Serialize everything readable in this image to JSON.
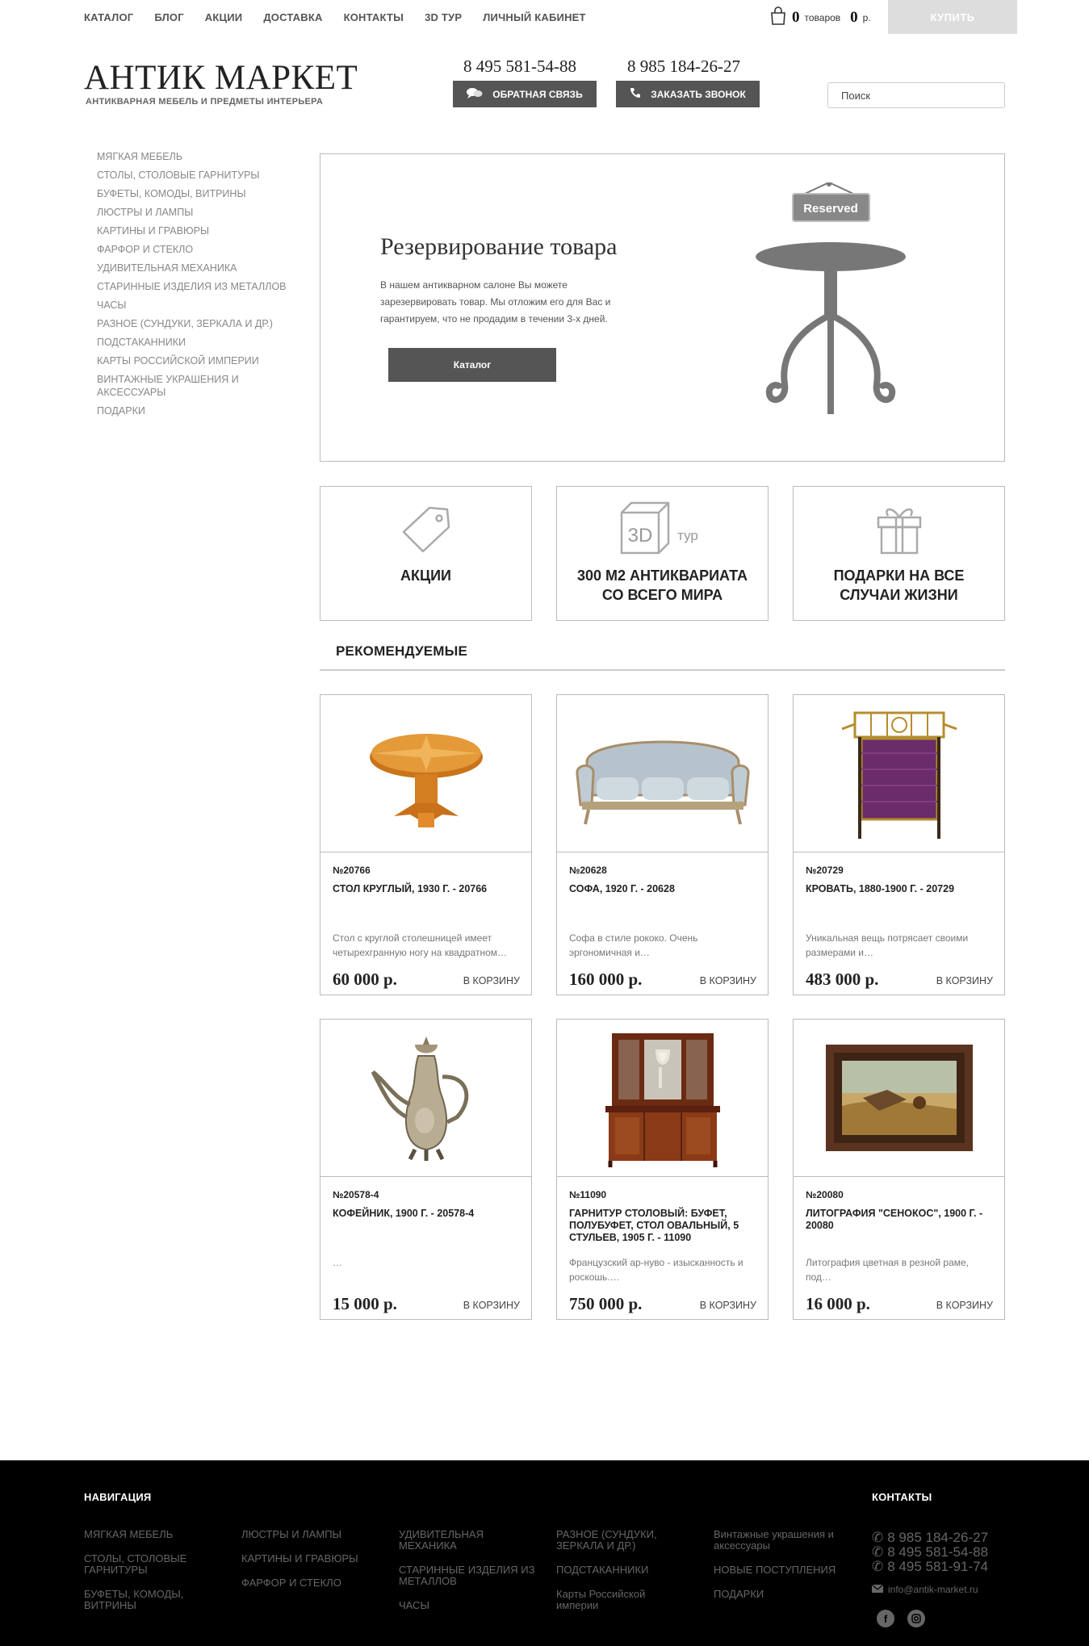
{
  "topnav": [
    "КАТАЛОГ",
    "БЛОГ",
    "АКЦИИ",
    "ДОСТАВКА",
    "КОНТАКТЫ",
    "3D ТУР",
    "ЛИЧНЫЙ КАБИНЕТ"
  ],
  "cart": {
    "count": "0",
    "count_label": "товаров",
    "sum": "0",
    "currency": "р.",
    "buy_label": "КУПИТЬ"
  },
  "header": {
    "logo": "АНТИК МАРКЕТ",
    "tagline": "АНТИКВАРНАЯ МЕБЕЛЬ И ПРЕДМЕТЫ ИНТЕРЬЕРА",
    "phone1": "8 495 581-54-88",
    "phone2": "8 985 184-26-27",
    "feedback_label": "ОБРАТНАЯ СВЯЗЬ",
    "callback_label": "ЗАКАЗАТЬ ЗВОНОК",
    "search_placeholder": "Поиск"
  },
  "sidebar": [
    "МЯГКАЯ МЕБЕЛЬ",
    "СТОЛЫ, СТОЛОВЫЕ ГАРНИТУРЫ",
    "БУФЕТЫ, КОМОДЫ, ВИТРИНЫ",
    "ЛЮСТРЫ И ЛАМПЫ",
    "КАРТИНЫ И ГРАВЮРЫ",
    "ФАРФОР И СТЕКЛО",
    "УДИВИТЕЛЬНАЯ МЕХАНИКА",
    "СТАРИННЫЕ ИЗДЕЛИЯ ИЗ МЕТАЛЛОВ",
    "ЧАСЫ",
    "РАЗНОЕ (СУНДУКИ, ЗЕРКАЛА И ДР.)",
    "ПОДСТАКАННИКИ",
    "КАРТЫ РОССИЙСКОЙ ИМПЕРИИ",
    "ВИНТАЖНЫЕ УКРАШЕНИЯ И АКСЕССУАРЫ",
    "ПОДАРКИ"
  ],
  "banner": {
    "title": "Резервирование товара",
    "text": "В нашем антикварном салоне Вы можете зарезервировать товар. Мы отложим его для Вас и гарантируем, что не продадим в течении 3-х дней.",
    "button": "Каталог",
    "sign": "Reserved"
  },
  "tiles": [
    {
      "label": "АКЦИИ",
      "icon": "tag-icon"
    },
    {
      "label": "300 М2 АНТИКВАРИАТА СО ВСЕГО МИРА",
      "icon": "3d-cube-icon",
      "icon_text": "3D",
      "icon_sub": "тур"
    },
    {
      "label": "ПОДАРКИ НА ВСЕ СЛУЧАИ ЖИЗНИ",
      "icon": "gift-icon"
    }
  ],
  "section_title": "РЕКОМЕНДУЕМЫЕ",
  "products": [
    {
      "sku": "№20766",
      "name": "СТОЛ КРУГЛЫЙ, 1930 Г. - 20766",
      "desc": "Стол с круглой столешницей имеет четырехгранную ногу на квадратном…",
      "price": "60 000 р.",
      "cart": "В КОРЗИНУ",
      "img": "round-table-image"
    },
    {
      "sku": "№20628",
      "name": "СОФА, 1920 Г. - 20628",
      "desc": "Софа в стиле рококо. Очень эргономичная и…",
      "price": "160 000 р.",
      "cart": "В КОРЗИНУ",
      "img": "sofa-image"
    },
    {
      "sku": "№20729",
      "name": "КРОВАТЬ, 1880-1900 Г. - 20729",
      "desc": "Уникальная вещь потрясает своими размерами и…",
      "price": "483 000 р.",
      "cart": "В КОРЗИНУ",
      "img": "bed-image"
    },
    {
      "sku": "№20578-4",
      "name": "КОФЕЙНИК, 1900 Г. - 20578-4",
      "desc": "…",
      "price": "15 000 р.",
      "cart": "В КОРЗИНУ",
      "img": "coffee-pot-image"
    },
    {
      "sku": "№11090",
      "name": "ГАРНИТУР СТОЛОВЫЙ: БУФЕТ, ПОЛУБУФЕТ, СТОЛ ОВАЛЬНЫЙ, 5 СТУЛЬЕВ, 1905 Г. - 11090",
      "desc": "Французский ар-нуво - изысканность и роскошь.…",
      "price": "750 000 р.",
      "cart": "В КОРЗИНУ",
      "img": "dining-set-image"
    },
    {
      "sku": "№20080",
      "name": "ЛИТОГРАФИЯ \"СЕНОКОС\", 1900 Г. - 20080",
      "desc": "Литография цветная  в резной раме, под…",
      "price": "16 000 р.",
      "cart": "В КОРЗИНУ",
      "img": "lithograph-image"
    }
  ],
  "footer": {
    "nav_title": "НАВИГАЦИЯ",
    "contacts_title": "КОНТАКТЫ",
    "columns": [
      [
        "МЯГКАЯ МЕБЕЛЬ",
        "СТОЛЫ, СТОЛОВЫЕ ГАРНИТУРЫ",
        "БУФЕТЫ, КОМОДЫ, ВИТРИНЫ"
      ],
      [
        "ЛЮСТРЫ И ЛАМПЫ",
        "КАРТИНЫ И ГРАВЮРЫ",
        "ФАРФОР И СТЕКЛО"
      ],
      [
        "УДИВИТЕЛЬНАЯ МЕХАНИКА",
        "СТАРИННЫЕ ИЗДЕЛИЯ ИЗ МЕТАЛЛОВ",
        "ЧАСЫ"
      ],
      [
        "РАЗНОЕ (СУНДУКИ, ЗЕРКАЛА И ДР.)",
        "ПОДСТАКАННИКИ",
        "Карты Российской империи"
      ],
      [
        "Винтажные украшения и аксессуары",
        "НОВЫЕ ПОСТУПЛЕНИЯ",
        "ПОДАРКИ"
      ]
    ],
    "phones": [
      "8 985 184-26-27",
      "8 495 581-54-88",
      "8 495 581-91-74"
    ],
    "email": "info@antik-market.ru",
    "social": [
      "facebook-icon",
      "instagram-icon"
    ]
  },
  "colors": {
    "button_dark": "#555555",
    "buy_disabled": "#dddddd",
    "footer_bg": "#000000",
    "border": "#bbbbbb"
  }
}
